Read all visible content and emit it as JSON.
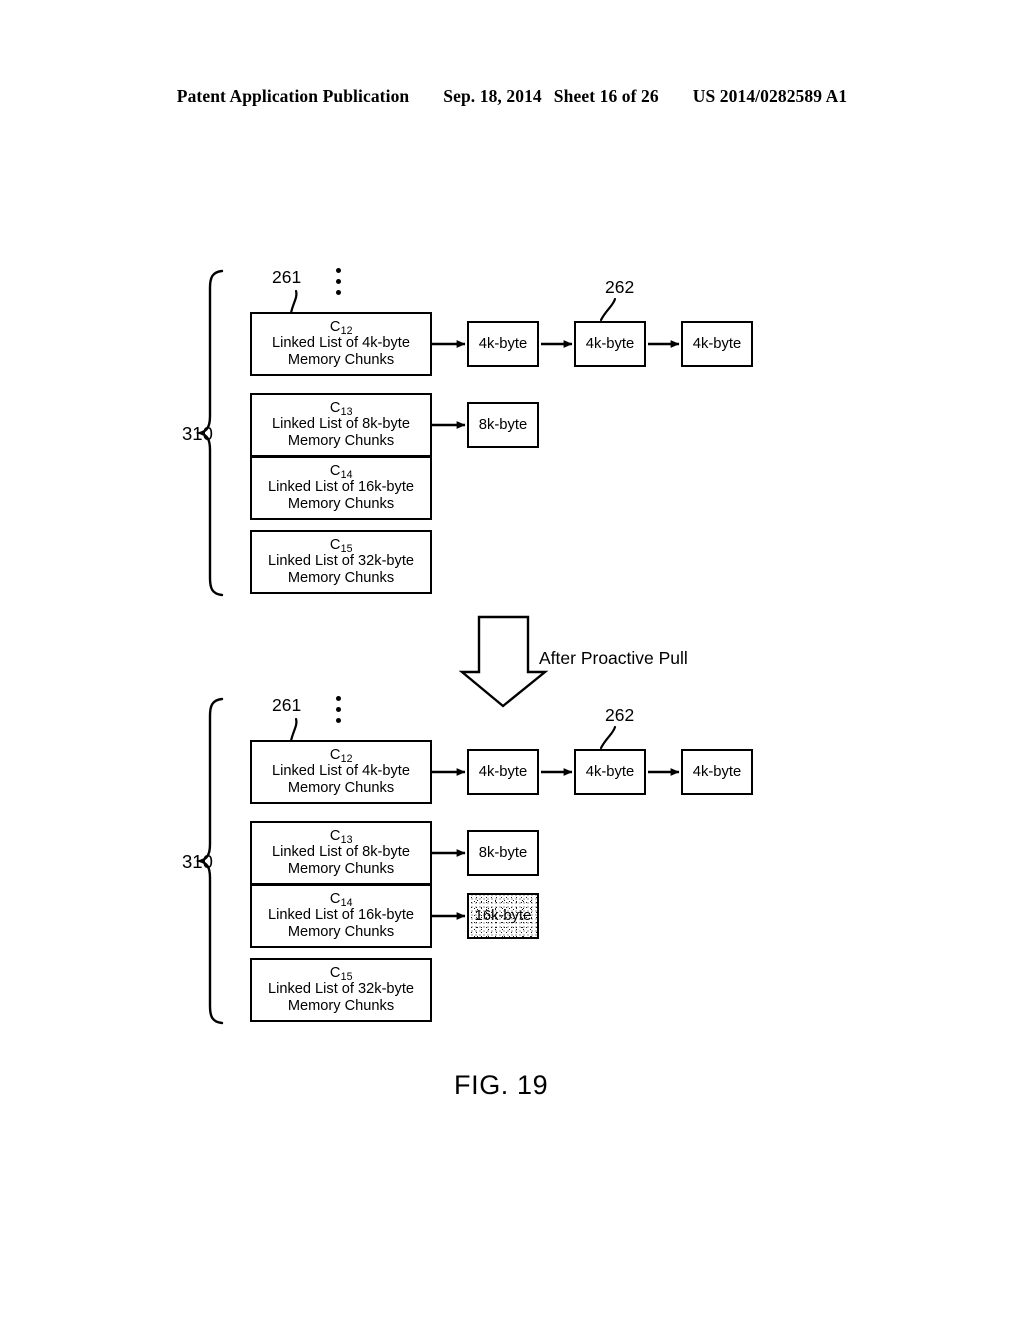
{
  "header": {
    "publication": "Patent Application Publication",
    "date": "Sep. 18, 2014",
    "sheet": "Sheet 16 of 26",
    "number": "US 2014/0282589 A1"
  },
  "figure": {
    "label": "FIG. 19",
    "transition_caption": "After Proactive Pull",
    "brace_numeral": "310",
    "list_head_numeral": "261",
    "chunk_numeral": "262",
    "ellipsis_icon": "vertical-ellipsis"
  },
  "diagram_before": {
    "name": "before-proactive-pull",
    "brace_label": "310",
    "callout_261": "261",
    "callout_262": "262",
    "lists": [
      {
        "class_name": "C",
        "class_sub": "12",
        "line1": "Linked List of 4k-byte",
        "line2": "Memory Chunks",
        "chunks": [
          "4k-byte",
          "4k-byte",
          "4k-byte"
        ],
        "highlighted": false
      },
      {
        "class_name": "C",
        "class_sub": "13",
        "line1": "Linked List of 8k-byte",
        "line2": "Memory Chunks",
        "chunks": [
          "8k-byte"
        ],
        "highlighted": false
      },
      {
        "class_name": "C",
        "class_sub": "14",
        "line1": "Linked List of 16k-byte",
        "line2": "Memory Chunks",
        "chunks": [],
        "highlighted": false
      },
      {
        "class_name": "C",
        "class_sub": "15",
        "line1": "Linked List of 32k-byte",
        "line2": "Memory Chunks",
        "chunks": [],
        "highlighted": false
      }
    ]
  },
  "diagram_after": {
    "name": "after-proactive-pull",
    "brace_label": "310",
    "callout_261": "261",
    "callout_262": "262",
    "lists": [
      {
        "class_name": "C",
        "class_sub": "12",
        "line1": "Linked List of 4k-byte",
        "line2": "Memory Chunks",
        "chunks": [
          "4k-byte",
          "4k-byte",
          "4k-byte"
        ],
        "highlighted": false
      },
      {
        "class_name": "C",
        "class_sub": "13",
        "line1": "Linked List of 8k-byte",
        "line2": "Memory Chunks",
        "chunks": [
          "8k-byte"
        ],
        "highlighted": false
      },
      {
        "class_name": "C",
        "class_sub": "14",
        "line1": "Linked List of 16k-byte",
        "line2": "Memory Chunks",
        "chunks": [
          "16k-byte"
        ],
        "highlighted": true
      },
      {
        "class_name": "C",
        "class_sub": "15",
        "line1": "Linked List of 32k-byte",
        "line2": "Memory Chunks",
        "chunks": [],
        "highlighted": false
      }
    ]
  }
}
